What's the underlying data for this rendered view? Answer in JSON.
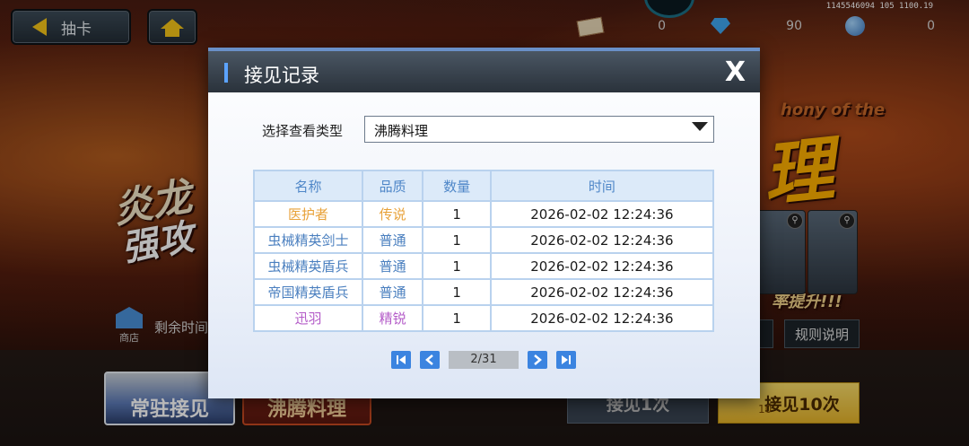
{
  "topbar": {
    "back_label": "抽卡",
    "currencies": [
      {
        "icon": "ticket-icon",
        "value": "0"
      },
      {
        "icon": "diamond-icon",
        "value": "90"
      },
      {
        "icon": "orb-icon",
        "value": "0"
      }
    ],
    "debug_text": "1145546094 105 1100.19"
  },
  "background": {
    "banner_left_line1": "炎龙",
    "banner_left_line2": "强攻",
    "banner_right_big": "理",
    "banner_right_small": "hony of the",
    "banner_rate_up": "率提升!!!",
    "shop_label": "商店",
    "remaining_time_label": "剩余时间",
    "rules_label": "规则说明",
    "tab_standard": "常驻接见",
    "tab_boiling": "沸腾料理",
    "action_single": "接见1次",
    "action_ten": "接见10次",
    "action_ten_count": "10"
  },
  "modal": {
    "title": "接见记录",
    "close_label": "X",
    "filter_label": "选择查看类型",
    "filter_value": "沸腾料理",
    "columns": [
      "名称",
      "品质",
      "数量",
      "时间"
    ],
    "rows": [
      {
        "name": "医护者",
        "quality": "传说",
        "count": "1",
        "time": "2026-02-02 12:24:36",
        "color": "#e8a23a"
      },
      {
        "name": "虫械精英剑士",
        "quality": "普通",
        "count": "1",
        "time": "2026-02-02 12:24:36",
        "color": "#4a7fbf"
      },
      {
        "name": "虫械精英盾兵",
        "quality": "普通",
        "count": "1",
        "time": "2026-02-02 12:24:36",
        "color": "#4a7fbf"
      },
      {
        "name": "帝国精英盾兵",
        "quality": "普通",
        "count": "1",
        "time": "2026-02-02 12:24:36",
        "color": "#4a7fbf"
      },
      {
        "name": "迅羽",
        "quality": "精锐",
        "count": "1",
        "time": "2026-02-02 12:24:36",
        "color": "#b45cc8"
      }
    ],
    "pager": {
      "current": "2/31"
    }
  }
}
